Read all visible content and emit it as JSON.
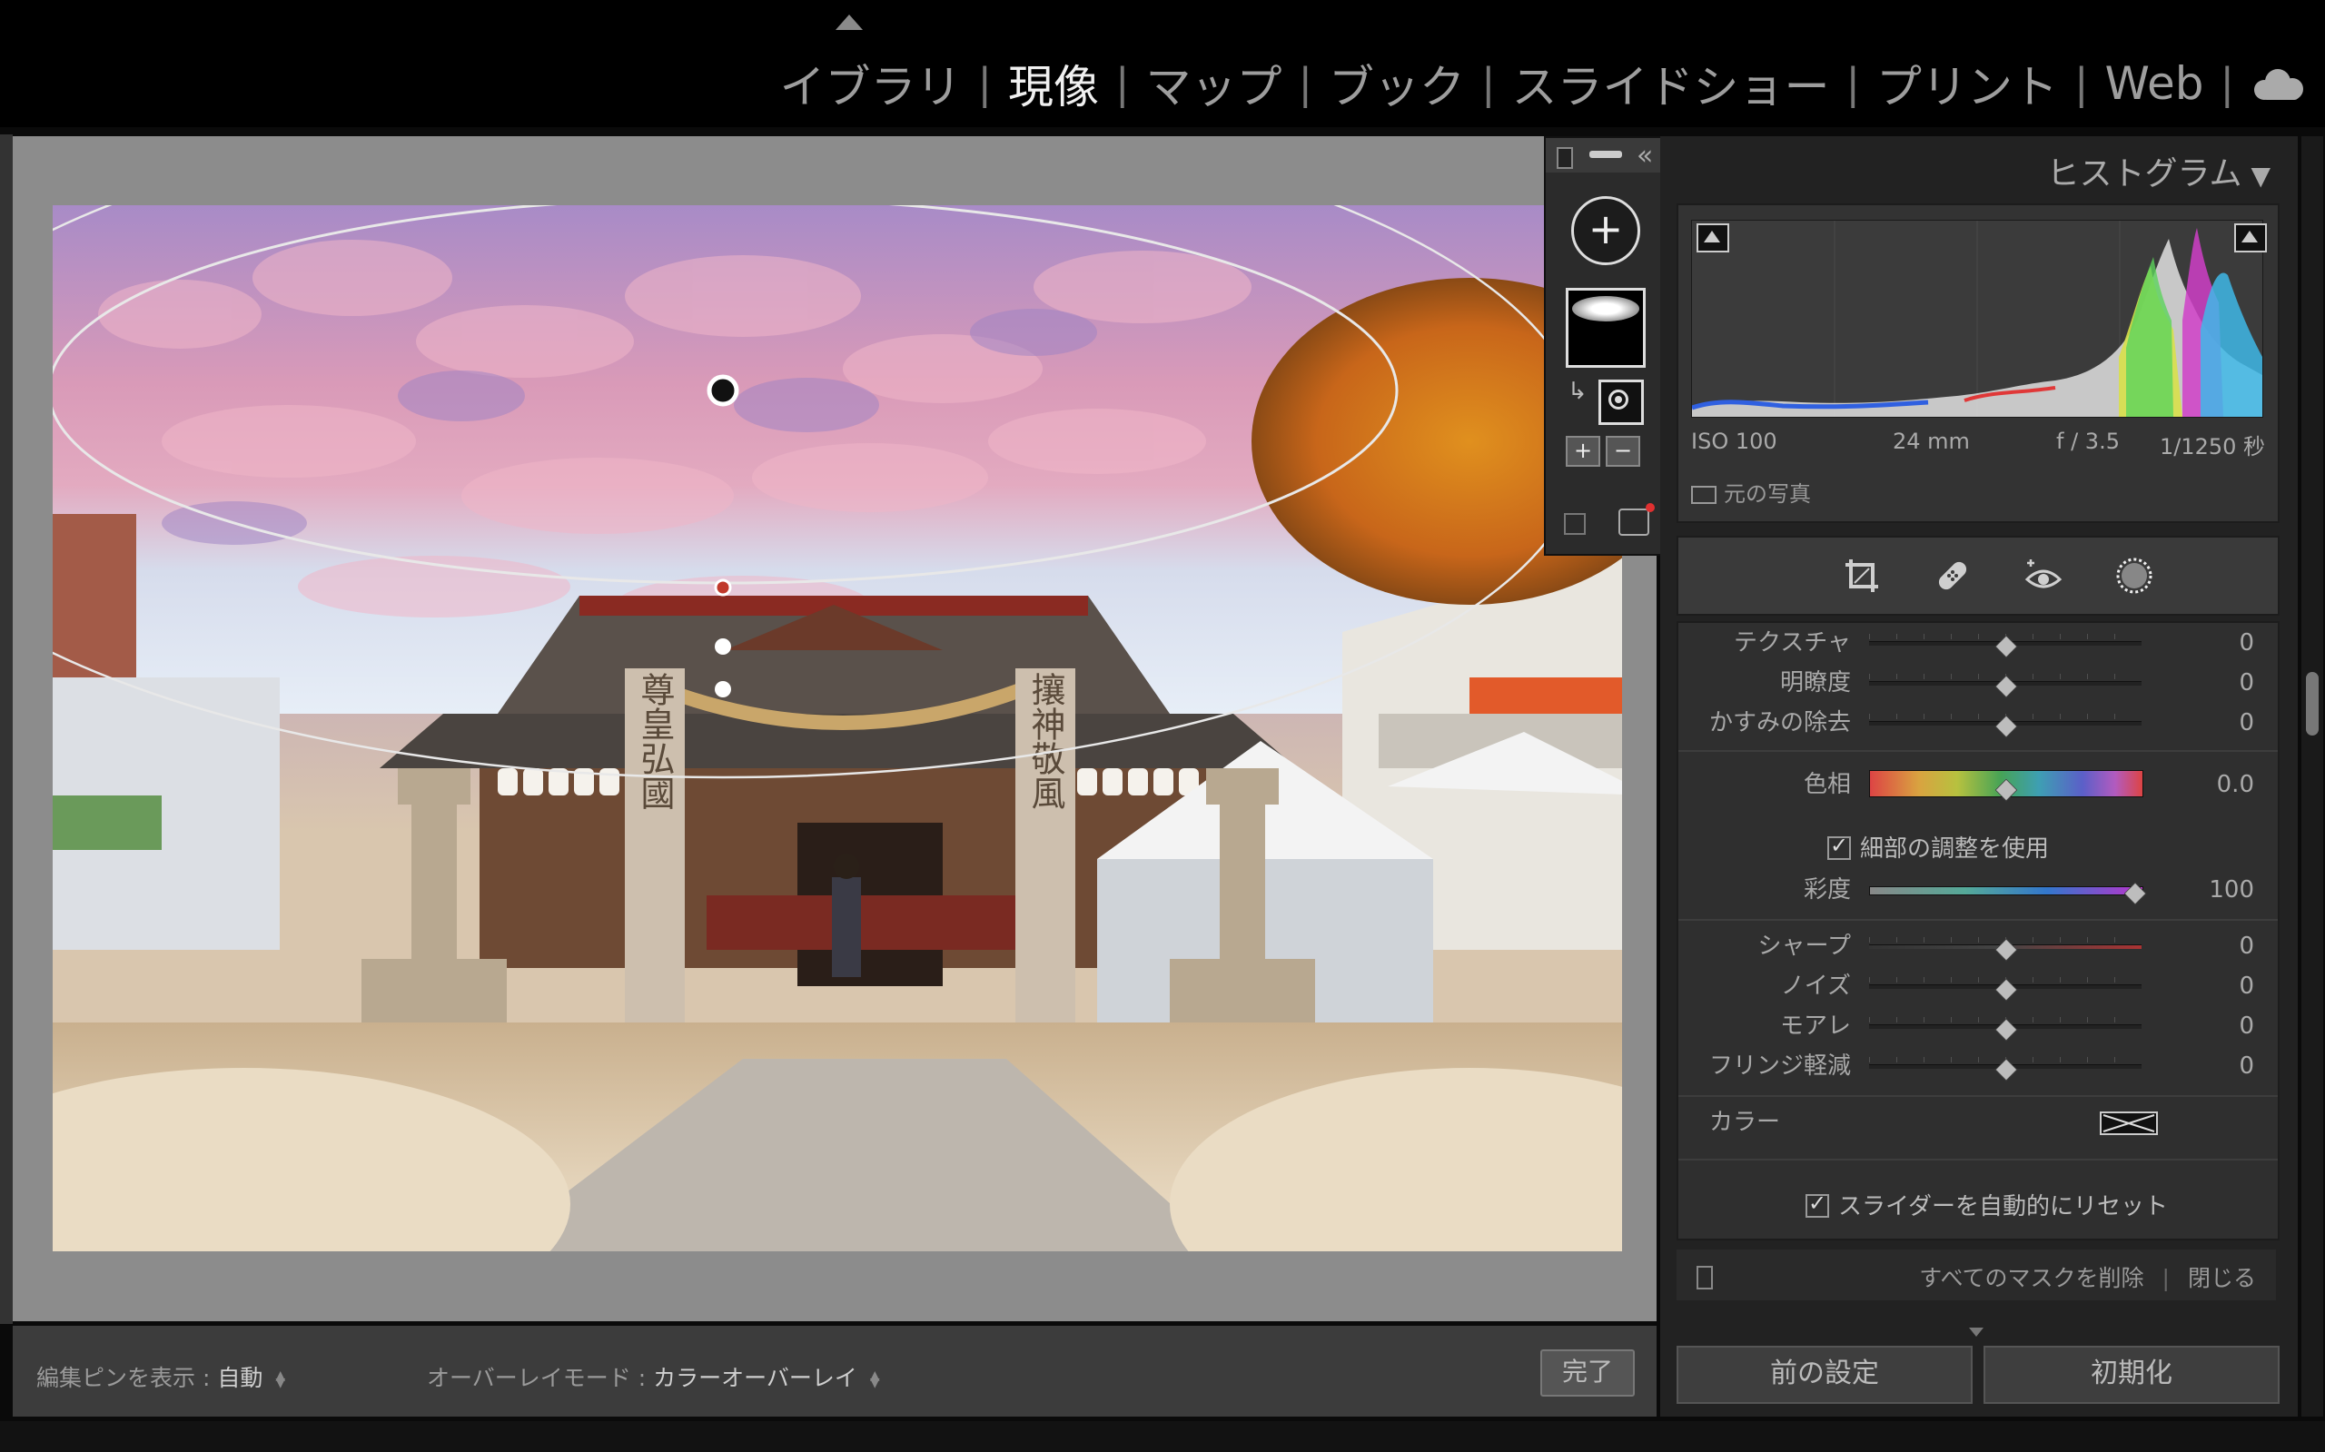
{
  "modules": {
    "items": [
      {
        "label": "イブラリ",
        "active": false
      },
      {
        "label": "現像",
        "active": true
      },
      {
        "label": "マップ",
        "active": false
      },
      {
        "label": "ブック",
        "active": false
      },
      {
        "label": "スライドショー",
        "active": false
      },
      {
        "label": "プリント",
        "active": false
      },
      {
        "label": "Web",
        "active": false
      }
    ],
    "separator": "|",
    "cloud_icon": "cloud-icon"
  },
  "photo": {
    "overlay_color": "#d86fb0",
    "left_pillar_text": "尊皇弘國",
    "right_pillar_text": "攘神敬風"
  },
  "bottom_toolbar": {
    "pins_label": "編集ピンを表示 :",
    "pins_value": "自動",
    "overlay_label": "オーバーレイモード :",
    "overlay_value": "カラーオーバーレイ",
    "done": "完了"
  },
  "mask_palette": {
    "add_symbol": "+",
    "plus": "+",
    "minus": "−",
    "collapse": "«"
  },
  "histogram": {
    "title": "ヒストグラム",
    "toggle": "▼",
    "iso": "ISO 100",
    "focal": "24 mm",
    "aperture": "f / 3.5",
    "shutter": "1/1250 秒",
    "original_photo": "元の写真"
  },
  "adjustments": {
    "sliders": [
      {
        "label": "テクスチャ",
        "value": "0",
        "pos": 0.5
      },
      {
        "label": "明瞭度",
        "value": "0",
        "pos": 0.5
      },
      {
        "label": "かすみの除去",
        "value": "0",
        "pos": 0.5
      }
    ],
    "hue": {
      "label": "色相",
      "value": "0.0",
      "pos": 0.5
    },
    "fine_adjust": "細部の調整を使用",
    "saturation": {
      "label": "彩度",
      "value": "100",
      "pos": 0.94
    },
    "detail_sliders": [
      {
        "label": "シャープ",
        "value": "0",
        "pos": 0.5
      },
      {
        "label": "ノイズ",
        "value": "0",
        "pos": 0.5
      },
      {
        "label": "モアレ",
        "value": "0",
        "pos": 0.5
      },
      {
        "label": "フリンジ軽減",
        "value": "0",
        "pos": 0.5
      }
    ],
    "color_label": "カラー",
    "auto_reset": "スライダーを自動的にリセット"
  },
  "mask_footer": {
    "delete_all": "すべてのマスクを削除",
    "close": "閉じる"
  },
  "panel_buttons": {
    "previous": "前の設定",
    "reset": "初期化"
  }
}
